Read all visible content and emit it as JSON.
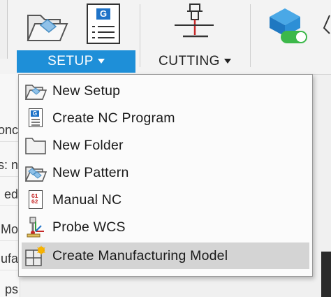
{
  "toolbar": {
    "tabs": [
      {
        "label": "SETUP"
      },
      {
        "label": "CUTTING"
      }
    ],
    "setup_icon_program_glyph": "G"
  },
  "left_panel": {
    "rows": [
      "onc",
      "s: n",
      "ed",
      "Mo",
      "ufa",
      "ps"
    ]
  },
  "menu": {
    "items": [
      {
        "label": "New Setup",
        "icon": "folder-open-icon"
      },
      {
        "label": "Create NC Program",
        "icon": "nc-program-icon",
        "glyph": "G"
      },
      {
        "label": "New Folder",
        "icon": "folder-icon"
      },
      {
        "label": "New Pattern",
        "icon": "pattern-folder-icon"
      },
      {
        "label": "Manual NC",
        "icon": "manual-nc-icon",
        "glyph_line1": "G1",
        "glyph_line2": "G2"
      },
      {
        "label": "Probe WCS",
        "icon": "probe-icon"
      },
      {
        "label": "Create Manufacturing Model",
        "icon": "manufacturing-model-icon",
        "highlighted": true
      }
    ]
  },
  "colors": {
    "accent": "#1e8fd8",
    "highlight": "#d4d4d4"
  }
}
